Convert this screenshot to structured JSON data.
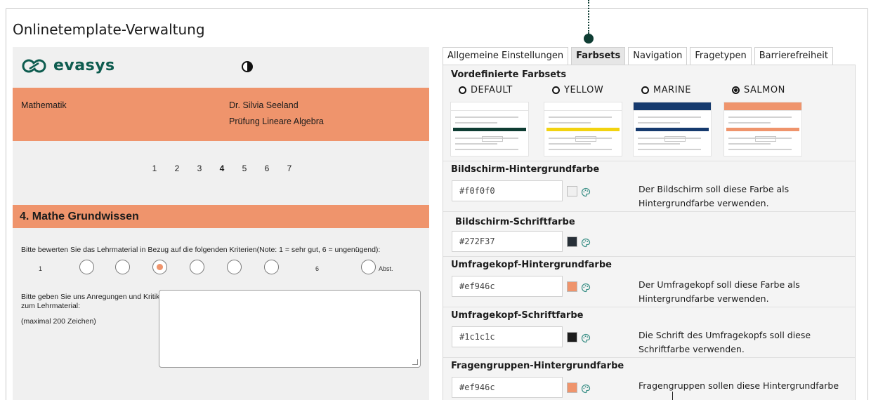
{
  "page_title": "Onlinetemplate-Verwaltung",
  "preview": {
    "logo_text": "evasys",
    "contrast_icon": "contrast-icon",
    "subject": "Mathematik",
    "teacher": "Dr. Silvia Seeland",
    "exam": "Prüfung Lineare Algebra",
    "pages": [
      {
        "label": "1",
        "bar_color": "#2e8b57",
        "active": false
      },
      {
        "label": "2",
        "bar_color": "#d8d8d8",
        "active": false
      },
      {
        "label": "3",
        "bar_color": "#e05a4f",
        "active": false
      },
      {
        "label": "4",
        "bar_color": "#f2c20f",
        "active": true
      },
      {
        "label": "5",
        "bar_color": "#e05a4f",
        "active": false
      },
      {
        "label": "6",
        "bar_color": "#d8d8d8",
        "active": false
      },
      {
        "label": "7",
        "bar_color": "#d8d8d8",
        "active": false
      }
    ],
    "group_title": "4. Mathe Grundwissen",
    "question": "Bitte bewerten Sie das Lehrmaterial in Bezug auf die folgenden Kriterien(Note: 1 = sehr gut, 6 = ungenügend):",
    "scale_min": "1",
    "scale_max": "6",
    "scale_abstain": "Abst.",
    "selected_rating": 3,
    "comment_label": "Bitte geben Sie uns Anregungen und Kritik zum Lehrmaterial:",
    "comment_hint": "(maximal 200 Zeichen)",
    "comment_value": ""
  },
  "tabs": [
    {
      "label": "Allgemeine Einstellungen",
      "active": false
    },
    {
      "label": "Farbsets",
      "active": true
    },
    {
      "label": "Navigation",
      "active": false
    },
    {
      "label": "Fragetypen",
      "active": false
    },
    {
      "label": "Barrierefreiheit",
      "active": false
    }
  ],
  "presets": {
    "title": "Vordefinierte Farbsets",
    "items": [
      {
        "label": "DEFAULT",
        "checked": false,
        "head_color": "#ffffff",
        "group_color": "#0f3d33"
      },
      {
        "label": "YELLOW",
        "checked": false,
        "head_color": "#ffffff",
        "group_color": "#f2d310"
      },
      {
        "label": "MARINE",
        "checked": false,
        "head_color": "#163a6e",
        "group_color": "#163a6e"
      },
      {
        "label": "SALMON",
        "checked": true,
        "head_color": "#ef946c",
        "group_color": "#ef946c"
      }
    ]
  },
  "color_settings": [
    {
      "title": "Bildschirm-Hintergrundfarbe",
      "value": "#f0f0f0",
      "swatch": "#f0f0f0",
      "description": "Der Bildschirm soll diese Farbe als Hintergrundfarbe verwenden."
    },
    {
      "title": "Bildschirm-Schriftfarbe",
      "value": "#272F37",
      "swatch": "#272f37",
      "description": ""
    },
    {
      "title": "Umfragekopf-Hintergrundfarbe",
      "value": "#ef946c",
      "swatch": "#ef946c",
      "description": "Der Umfragekopf soll diese Farbe als Hintergrundfarbe verwenden."
    },
    {
      "title": "Umfragekopf-Schriftfarbe",
      "value": "#1c1c1c",
      "swatch": "#1c1c1c",
      "description": "Die Schrift des Umfragekopfs soll diese Schriftfarbe verwenden."
    },
    {
      "title": "Fragengruppen-Hintergrundfarbe",
      "value": "#ef946c",
      "swatch": "#ef946c",
      "description": "Fragengruppen sollen diese Hintergrundfarbe"
    }
  ],
  "colors": {
    "brand_teal": "#0d5c4f",
    "salmon": "#ef946c",
    "annotation": "#0f3d33"
  }
}
